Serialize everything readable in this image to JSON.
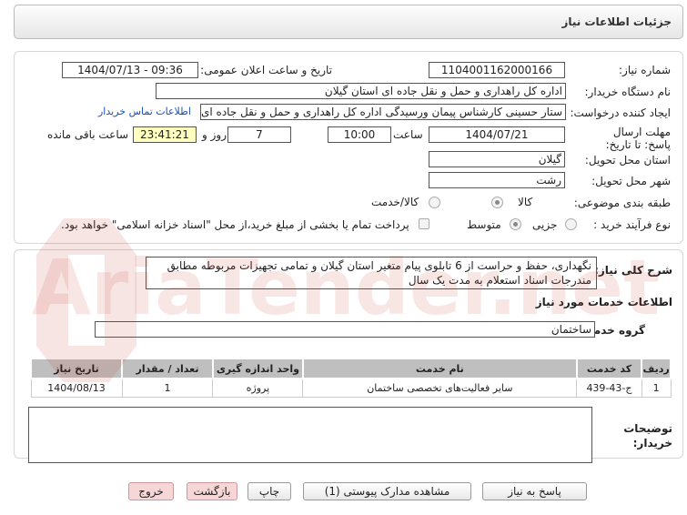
{
  "header": {
    "title": "جزئیات اطلاعات نیاز"
  },
  "form": {
    "need_number_label": "شماره نیاز:",
    "need_number": "1104001162000166",
    "announce_label": "تاریخ و ساعت اعلان عمومی:",
    "announce_value": "1404/07/13 - 09:36",
    "buyer_org_label": "نام دستگاه خریدار:",
    "buyer_org": "اداره کل راهداری و حمل و نقل جاده ای استان گیلان",
    "requester_label": "ایجاد کننده درخواست:",
    "requester": "ستار حسینی کارشناس پیمان ورسیدگی اداره کل راهداری و حمل و نقل جاده ای",
    "contact_link": "اطلاعات تماس خریدار",
    "deadline_label": "مهلت ارسال پاسخ: تا تاریخ:",
    "deadline_date": "1404/07/21",
    "time_label": "ساعت",
    "deadline_time": "10:00",
    "days_value": "7",
    "days_label": "روز و",
    "remaining_time": "23:41:21",
    "remaining_label": "ساعت باقی مانده",
    "province_label": "استان محل تحویل:",
    "province": "گیلان",
    "city_label": "شهر محل تحویل:",
    "city": "رشت",
    "category_label": "طبقه بندی موضوعی:",
    "category_options": [
      "کالا",
      "کالا/خدمت"
    ],
    "process_label": "نوع فرآیند خرید :",
    "process_options": [
      "جزیی",
      "متوسط"
    ],
    "payment_note": "پرداخت تمام یا بخشی از مبلغ خرید،از محل \"اسناد خزانه اسلامی\" خواهد بود."
  },
  "description": {
    "label": "شرح کلی نیاز:",
    "text": "نگهداری، حفظ و حراست از 6 تابلوی پیام متغیر استان گیلان و تمامی تجهیزات مربوطه مطابق مندرجات اسناد استعلام به مدت یک سال"
  },
  "services": {
    "section_title": "اطلاعات خدمات مورد نیاز",
    "group_label": "گروه خدمت:",
    "group_value": "ساختمان",
    "columns": [
      "ردیف",
      "کد خدمت",
      "نام خدمت",
      "واحد اندازه گیری",
      "تعداد / مقدار",
      "تاریخ نیاز"
    ],
    "rows": [
      [
        "1",
        "ج-43-439",
        "سایر فعالیت‌های تخصصی ساختمان",
        "پروژه",
        "1",
        "1404/08/13"
      ]
    ]
  },
  "buyer_notes_label": "توضیحات خریدار:",
  "buttons": {
    "reply": "پاسخ به نیاز",
    "attachments": "مشاهده مدارک پیوستی (1)",
    "print": "چاپ",
    "back": "بازگشت",
    "exit": "خروج"
  },
  "watermark": "AriaTender.net",
  "colors": {
    "link": "#1a4fb5",
    "remaining_bg": "#ffffc0",
    "header_bg": "#e6e6e6",
    "table_header": "#bfbfbf"
  }
}
